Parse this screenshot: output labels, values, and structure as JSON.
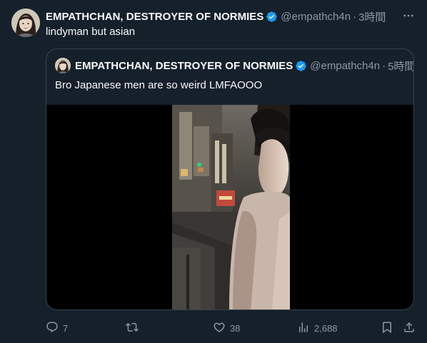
{
  "colors": {
    "background": "#15202b",
    "text": "#f7f9f9",
    "secondary": "#8b98a5",
    "border": "#38444d",
    "verified": "#1d9bf0"
  },
  "tweet": {
    "author_name": "EMPATHCHAN, DESTROYER OF NORMIES",
    "handle": "@empathch4n",
    "separator": "·",
    "time": "3時間",
    "text": "lindyman but asian",
    "verified_icon": "verified-badge-icon",
    "more_icon": "more-icon"
  },
  "quoted": {
    "author_name": "EMPATHCHAN, DESTROYER OF NORMIES",
    "handle": "@empathch4n",
    "separator": "·",
    "time": "5時間",
    "text": "Bro Japanese men are so weird LMFAOOO",
    "media_type": "video"
  },
  "actions": {
    "reply_count": "7",
    "retweet_count": "",
    "like_count": "38",
    "views_count": "2,688",
    "icons": [
      "reply-icon",
      "retweet-icon",
      "like-icon",
      "views-icon",
      "bookmark-icon",
      "share-icon"
    ]
  }
}
